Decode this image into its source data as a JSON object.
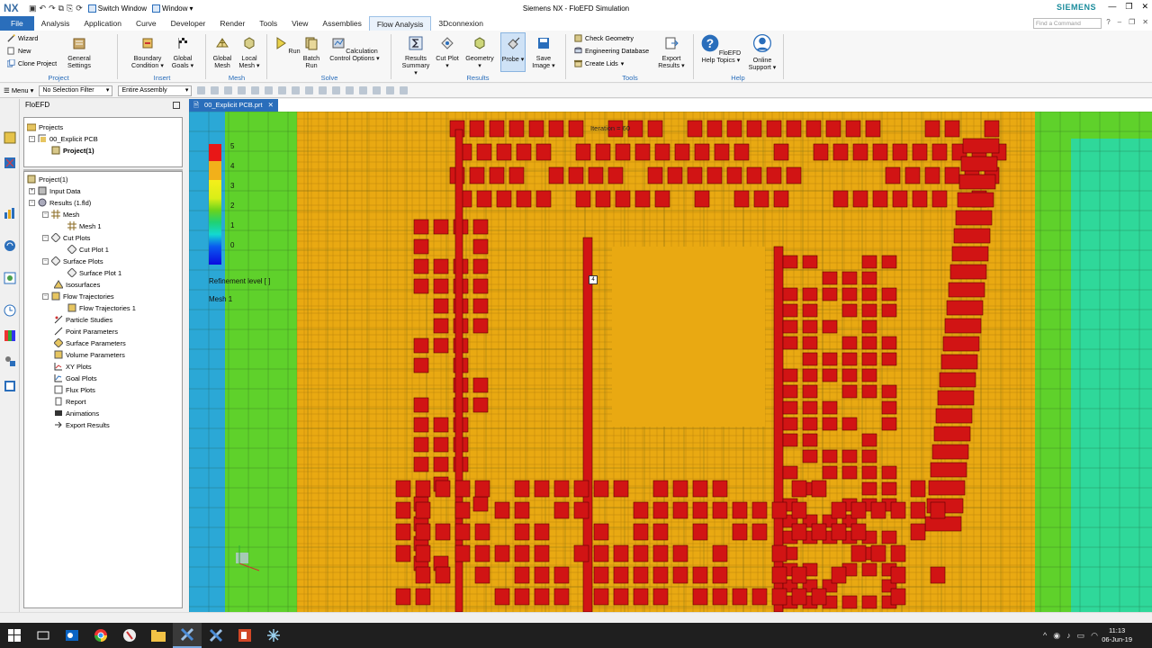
{
  "window": {
    "app_logo": "NX",
    "title": "Siemens NX - FloEFD Simulation",
    "brand": "SIEMENS",
    "switch_window": "Switch Window",
    "window_menu": "Window",
    "search_placeholder": "Find a Command"
  },
  "tabs": [
    "File",
    "Analysis",
    "Application",
    "Curve",
    "Developer",
    "Render",
    "Tools",
    "View",
    "Assemblies",
    "Flow Analysis",
    "3Dconnexion"
  ],
  "active_tab": "Flow Analysis",
  "ribbon": {
    "project": {
      "label": "Project",
      "wizard": "Wizard",
      "new": "New",
      "clone": "Clone Project",
      "general": "General Settings"
    },
    "insert": {
      "label": "Insert",
      "boundary": "Boundary Condition",
      "goals": "Global Goals"
    },
    "mesh": {
      "label": "Mesh",
      "global": "Global Mesh",
      "local": "Local Mesh"
    },
    "solve": {
      "label": "Solve",
      "run": "Run",
      "batch": "Batch Run",
      "calc": "Calculation Control Options"
    },
    "results": {
      "label": "Results",
      "summary": "Results Summary",
      "cut": "Cut Plot",
      "geometry": "Geometry",
      "probe": "Probe",
      "save": "Save Image"
    },
    "tools": {
      "label": "Tools",
      "check": "Check Geometry",
      "engdb": "Engineering Database",
      "lids": "Create Lids",
      "export": "Export Results"
    },
    "help": {
      "label": "Help",
      "topics": "FloEFD Help Topics",
      "support": "Online Support"
    }
  },
  "cmdbar": {
    "menu": "Menu",
    "filter": "No Selection Filter",
    "assembly": "Entire Assembly"
  },
  "panel": {
    "title": "FloEFD",
    "projects_tree": {
      "root": "Projects",
      "part": "00_Explicit PCB",
      "project": "Project(1)"
    },
    "analysis_tree": {
      "root": "Project(1)",
      "input": "Input Data",
      "results": "Results (1.fld)",
      "mesh": "Mesh",
      "mesh1": "Mesh 1",
      "cutplots": "Cut Plots",
      "cutplot1": "Cut Plot 1",
      "surfplots": "Surface Plots",
      "surfplot1": "Surface Plot 1",
      "iso": "Isosurfaces",
      "flowtraj": "Flow Trajectories",
      "flowtraj1": "Flow Trajectories 1",
      "particle": "Particle Studies",
      "point": "Point Parameters",
      "surfparam": "Surface Parameters",
      "volparam": "Volume Parameters",
      "xy": "XY Plots",
      "goal": "Goal Plots",
      "flux": "Flux Plots",
      "report": "Report",
      "anim": "Animations",
      "export": "Export Results"
    }
  },
  "viewport": {
    "tab": "00_Explicit PCB.prt",
    "iteration": "Iteration = 60",
    "legend_ticks": [
      "5",
      "4",
      "3",
      "2",
      "1",
      "0"
    ],
    "legend_title": "Refinement level [ ]",
    "legend_mesh": "Mesh 1",
    "probe_value": "4"
  },
  "colors": {
    "red": "#d11414",
    "orange": "#e9a912",
    "green": "#5fd12b",
    "lightgreen": "#2fd89a",
    "accent": "#2a6ebb"
  },
  "taskbar": {
    "time": "11:13",
    "date": "06-Jun-19"
  }
}
